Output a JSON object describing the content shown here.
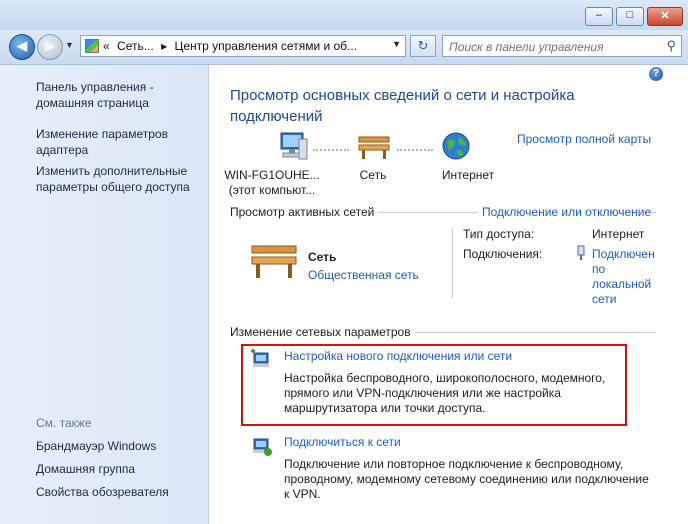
{
  "window": {
    "min_glyph": "–",
    "max_glyph": "□",
    "close_glyph": "✕"
  },
  "address": {
    "crumbs": [
      "«",
      "Сеть...",
      "▸",
      "Центр управления сетями и об..."
    ]
  },
  "search": {
    "placeholder": "Поиск в панели управления"
  },
  "sidebar": {
    "links": [
      "Панель управления -",
      "домашняя страница",
      "Изменение параметров",
      "адаптера",
      "Изменить дополнительные",
      "параметры общего доступа"
    ],
    "see_also": "См. также",
    "see_also_links": [
      "Брандмауэр Windows",
      "Домашняя группа",
      "Свойства обозревателя"
    ]
  },
  "main": {
    "title_line1": "Просмотр основных сведений о сети и настройка",
    "title_line2": "подключений",
    "full_map_link": "Просмотр полной карты",
    "map": {
      "computer_line1": "WIN-FG1OUHE...",
      "computer_line2": "(этот компьют...",
      "network": "Сеть",
      "internet": "Интернет"
    },
    "active_networks_header": "Просмотр активных сетей",
    "connect_disconnect_link": "Подключение или отключение",
    "network_name": "Сеть",
    "network_type_link": "Общественная сеть",
    "access_type_label": "Тип доступа:",
    "access_type_value": "Интернет",
    "connections_label": "Подключения:",
    "connections_value": [
      "Подключен",
      "по",
      "локальной",
      "сети"
    ],
    "change_settings_header": "Изменение сетевых параметров",
    "tasks": [
      {
        "title": "Настройка нового подключения или сети",
        "desc": [
          "Настройка беспроводного, широкополосного, модемного,",
          "прямого или VPN-подключения или же настройка",
          "маршрутизатора или точки доступа."
        ]
      },
      {
        "title": "Подключиться к сети",
        "desc": [
          "Подключение или повторное подключение к беспроводному,",
          "проводному, модемному сетевому соединению или подключение",
          "к VPN."
        ]
      }
    ]
  },
  "colors": {
    "link": "#1b5ec3",
    "title": "#1c4a96",
    "highlight_box": "#d0121a"
  },
  "icons": [
    "back-arrow-icon",
    "forward-arrow-icon",
    "control-panel-icon",
    "refresh-icon",
    "search-icon",
    "help-icon",
    "computer-icon",
    "bench-icon",
    "globe-icon",
    "new-connection-icon",
    "connect-network-icon",
    "network-adapter-icon"
  ]
}
